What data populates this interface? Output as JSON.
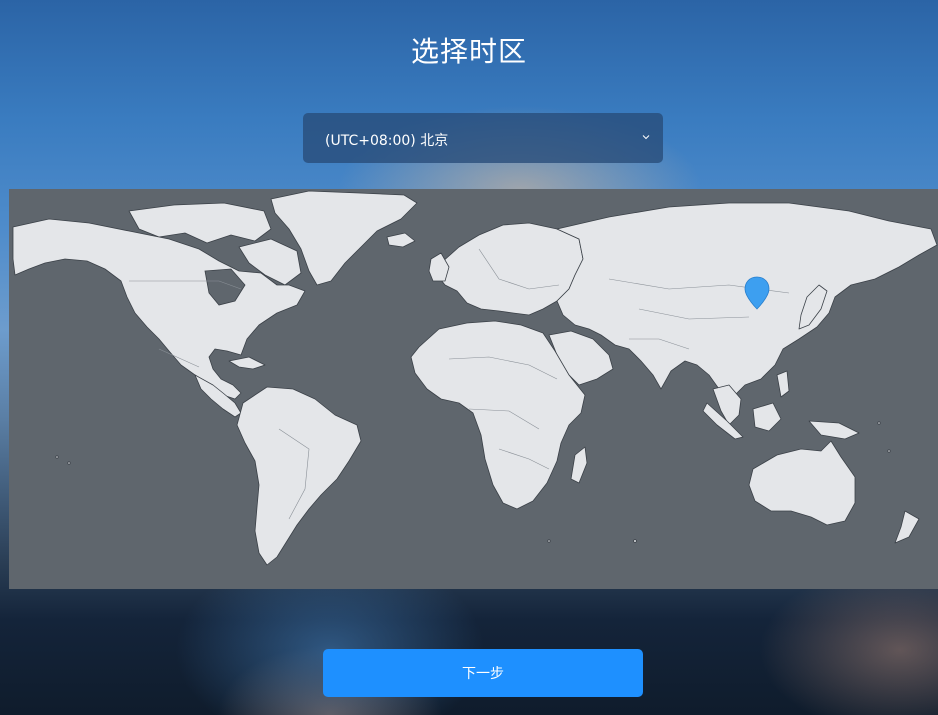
{
  "page": {
    "title": "选择时区"
  },
  "timezone_select": {
    "selected": "(UTC+08:00) 北京",
    "icon": "chevron-down-icon"
  },
  "map": {
    "marker_icon": "location-pin-icon",
    "marker_color": "#3d9ff0"
  },
  "actions": {
    "next_label": "下一步"
  },
  "colors": {
    "accent": "#1e90ff",
    "map_ocean": "#5f666d",
    "map_land": "#e4e6e9"
  }
}
